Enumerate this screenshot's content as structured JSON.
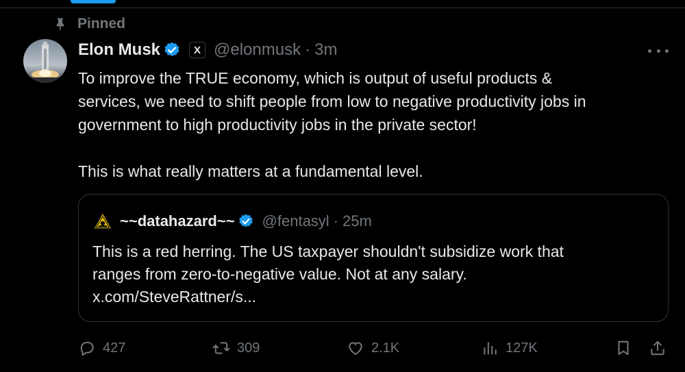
{
  "pinned_label": "Pinned",
  "tweet": {
    "author_name": "Elon Musk",
    "affiliate_badge": "X",
    "handle": "@elonmusk",
    "separator": "·",
    "time": "3m",
    "text_lines": [
      "To improve the TRUE economy, which is output of useful products &",
      "services, we need to shift people from low to negative productivity jobs in",
      "government to high productivity jobs in the private sector!",
      "",
      "This is what really matters at a fundamental level."
    ]
  },
  "quote": {
    "author_name": "~~datahazard~~",
    "handle": "@fentasyl",
    "separator": "·",
    "time": "25m",
    "text_lines": [
      "This is a red herring. The US taxpayer shouldn't subsidize work that",
      "ranges from zero-to-negative value. Not at any salary.",
      "x.com/SteveRattner/s..."
    ]
  },
  "actions": {
    "replies": "427",
    "reposts": "309",
    "likes": "2.1K",
    "views": "127K"
  },
  "icons": {
    "pin": "pin-icon",
    "verified": "verified-badge-icon",
    "more": "more-icon",
    "reply": "reply-icon",
    "repost": "repost-icon",
    "like": "heart-icon",
    "views": "views-icon",
    "bookmark": "bookmark-icon",
    "share": "share-icon"
  },
  "colors": {
    "background": "#000000",
    "text": "#e7e9ea",
    "muted": "#71767b",
    "accent": "#1d9bf0",
    "border": "#2f3336"
  }
}
